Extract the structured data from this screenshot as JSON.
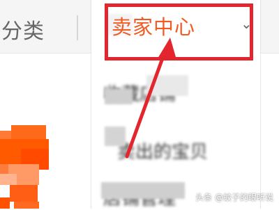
{
  "topbar": {
    "category_label": "分类",
    "seller_center_label": "卖家中心"
  },
  "dropdown": {
    "items": [
      {
        "label": "收藏店铺"
      },
      {
        "label": "卖出的宝贝"
      },
      {
        "label": "店铺管理"
      }
    ]
  },
  "watermark": "头条 @蚊子的眼听说",
  "colors": {
    "accent": "#f15a22",
    "annotation": "#e3262d",
    "avatar": "#ff5a00"
  },
  "icons": [
    "chevron-down-icon",
    "annotation-arrow-icon"
  ]
}
